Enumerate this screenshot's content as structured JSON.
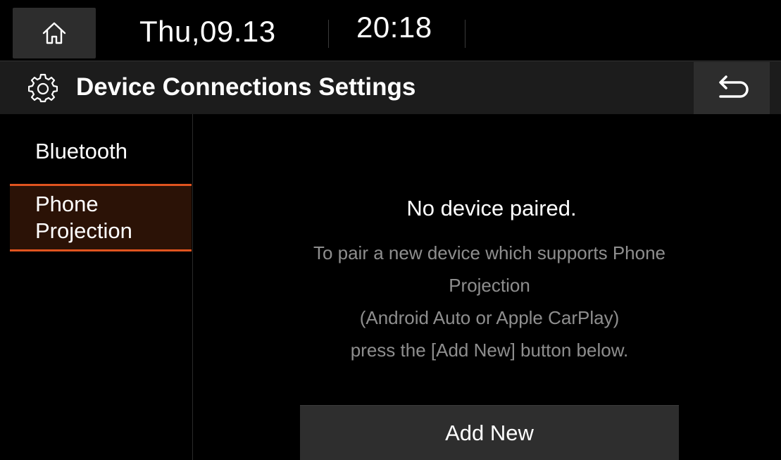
{
  "status_bar": {
    "date": "Thu,09.13",
    "time": "20:18",
    "home_icon": "home-icon"
  },
  "header": {
    "title": "Device Connections Settings",
    "settings_icon": "gear-icon",
    "back_icon": "back-arrow-icon"
  },
  "sidebar": {
    "items": [
      {
        "label": "Bluetooth",
        "selected": false
      },
      {
        "label": "Phone Projection",
        "selected": true
      }
    ]
  },
  "main": {
    "status": "No device paired.",
    "description_lines": [
      "To pair a new device which supports Phone",
      "Projection",
      "(Android Auto or Apple CarPlay)",
      "press the [Add New] button below."
    ],
    "add_button_label": "Add New"
  },
  "colors": {
    "background": "#000000",
    "accent": "#e0541f",
    "selected_bg": "#2b1206",
    "button_bg": "#2e2e2e",
    "secondary_text": "#8e8e8e"
  }
}
